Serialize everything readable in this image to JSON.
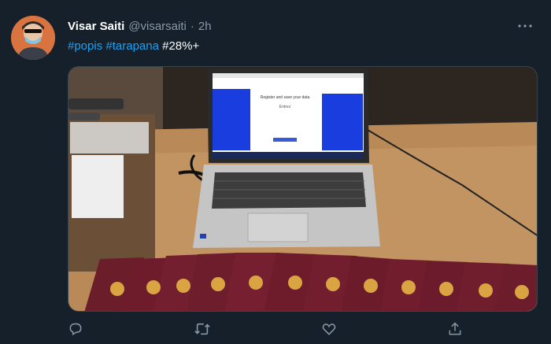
{
  "tweet": {
    "author_name": "Visar Saiti",
    "handle": "@visarsaiti",
    "separator": "·",
    "time": "2h",
    "text": {
      "hashtag1": "#popis",
      "hashtag2": "#tarapana",
      "rest": "#28%+"
    },
    "avatar_icon": "avatar-masked-person",
    "more_icon": "more-dots-icon",
    "media": {
      "screen_title": "Register and save your data",
      "screen_subtitle": "Entrez",
      "description_icon": "photo"
    },
    "actions": {
      "reply_icon": "reply-icon",
      "retweet_icon": "retweet-icon",
      "like_icon": "like-icon",
      "share_icon": "share-icon"
    }
  },
  "colors": {
    "background": "#15202b",
    "accent": "#1da1f2",
    "muted": "#8899a6"
  }
}
